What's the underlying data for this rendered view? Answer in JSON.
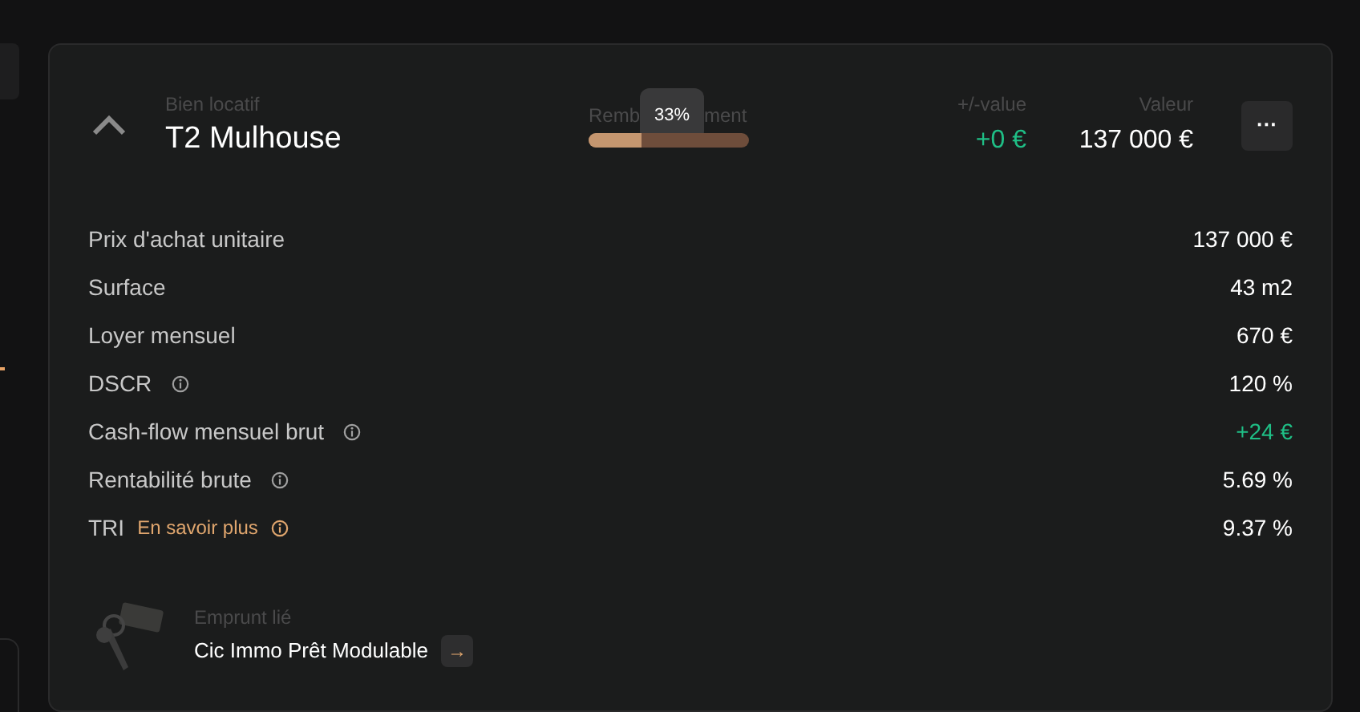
{
  "card": {
    "expanded": true,
    "category": "Bien locatif",
    "title": "T2 Mulhouse",
    "repayment": {
      "label_start": "Remb",
      "label_end": "ment",
      "tooltip": "33%",
      "level": 0.33
    },
    "gain": {
      "label": "+/-value",
      "value": "+0 €"
    },
    "valeur": {
      "label": "Valeur",
      "value": "137 000 €"
    },
    "menu": "···",
    "details": [
      {
        "label": "Prix d'achat unitaire",
        "value": "137 000 €",
        "info": false,
        "positive": false
      },
      {
        "label": "Surface",
        "value": "43 m2",
        "info": false,
        "positive": false
      },
      {
        "label": "Loyer mensuel",
        "value": "670 €",
        "info": false,
        "positive": false
      },
      {
        "label": "DSCR",
        "value": "120 %",
        "info": true,
        "positive": false
      },
      {
        "label": "Cash-flow mensuel brut",
        "value": "+24 €",
        "info": true,
        "positive": true
      },
      {
        "label": "Rentabilité brute",
        "value": "5.69 %",
        "info": true,
        "positive": false
      },
      {
        "label": "TRI",
        "link": "En savoir plus",
        "value": "9.37 %",
        "info": true,
        "positive": false
      }
    ],
    "loan": {
      "label": "Emprunt lié",
      "name": "Cic Immo Prêt Modulable",
      "arrow": "→"
    }
  }
}
